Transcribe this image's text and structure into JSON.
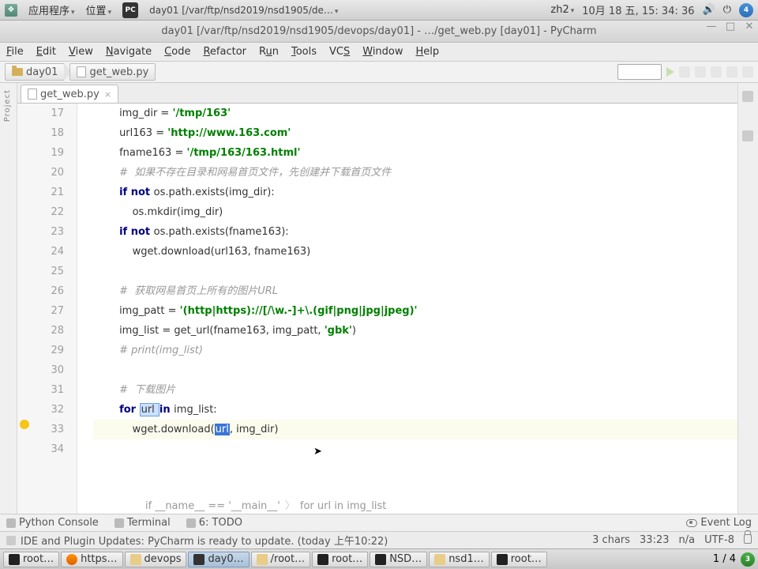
{
  "gnome": {
    "apps": "应用程序",
    "places": "位置",
    "active_window": "day01 [/var/ftp/nsd2019/nsd1905/de…",
    "input": "zh2",
    "date": "10月 18 五,  15: 34: 36",
    "badge": "4"
  },
  "window": {
    "title": "day01 [/var/ftp/nsd2019/nsd1905/devops/day01] - …/get_web.py [day01] - PyCharm",
    "minimize": "—",
    "maximize": "□",
    "close": "✕"
  },
  "menu": {
    "file": "File",
    "edit": "Edit",
    "view": "View",
    "navigate": "Navigate",
    "code": "Code",
    "refactor": "Refactor",
    "run": "Run",
    "tools": "Tools",
    "vcs": "VCS",
    "window": "Window",
    "help": "Help"
  },
  "breadcrumb": {
    "folder": "day01",
    "file": "get_web.py"
  },
  "tab": {
    "label": "get_web.py",
    "close": "×"
  },
  "code": {
    "lines": [
      17,
      18,
      19,
      20,
      21,
      22,
      23,
      24,
      25,
      26,
      27,
      28,
      29,
      30,
      31,
      32,
      33,
      34
    ],
    "l17": {
      "indent": "        ",
      "var": "img_dir = ",
      "str": "'/tmp/163'"
    },
    "l18": {
      "indent": "        ",
      "var": "url163 = ",
      "str": "'http://www.163.com'"
    },
    "l19": {
      "indent": "        ",
      "var": "fname163 = ",
      "str": "'/tmp/163/163.html'"
    },
    "l20": {
      "indent": "        ",
      "cmt": "#  如果不存在目录和网易首页文件，先创建并下载首页文件"
    },
    "l21": {
      "indent": "        ",
      "kw": "if not ",
      "code": "os.path.exists(img_dir):"
    },
    "l22": {
      "indent": "            ",
      "code": "os.mkdir(img_dir)"
    },
    "l23": {
      "indent": "        ",
      "kw": "if not ",
      "code": "os.path.exists(fname163):"
    },
    "l24": {
      "indent": "            ",
      "code": "wget.download(url163, fname163)"
    },
    "l25": "",
    "l26": {
      "indent": "        ",
      "cmt": "#  获取网易首页上所有的图片URL"
    },
    "l27": {
      "indent": "        ",
      "var": "img_patt = ",
      "str": "'(http|https)://[/\\w.-]+\\.(gif|png|jpg|jpeg)'"
    },
    "l28": {
      "indent": "        ",
      "pre": "img_list = get_url(fname163, img_patt, ",
      "str": "'gbk'",
      "post": ")"
    },
    "l29": {
      "indent": "        ",
      "cmt": "# print(img_list)"
    },
    "l30": "",
    "l31": {
      "indent": "        ",
      "cmt": "#  下载图片"
    },
    "l32": {
      "indent": "        ",
      "kw1": "for ",
      "var": "url ",
      "kw2": "in ",
      "code": "img_list:"
    },
    "l33": {
      "indent": "            ",
      "pre": "wget.download(",
      "sel": "url",
      "post": ", img_dir)"
    },
    "l34": ""
  },
  "mini_bread": {
    "a": "if __name__ == '__main__'",
    "b": "for url in img_list"
  },
  "bottom": {
    "pyconsole": "Python Console",
    "terminal": "Terminal",
    "todo": "6: TODO",
    "eventlog": "Event Log"
  },
  "status": {
    "msg": "IDE and Plugin Updates: PyCharm is ready to update. (today 上午10:22)",
    "sel": "3 chars",
    "pos": "33:23",
    "lf": "n/a",
    "enc": "UTF-8"
  },
  "taskbar": {
    "items": [
      {
        "label": "root…"
      },
      {
        "label": "https…"
      },
      {
        "label": "devops"
      },
      {
        "label": "day0…"
      },
      {
        "label": "/root…"
      },
      {
        "label": "root…"
      },
      {
        "label": "NSD…"
      },
      {
        "label": "nsd1…"
      },
      {
        "label": "root…"
      }
    ],
    "ws": "1 / 4",
    "tray_badge": "3"
  }
}
